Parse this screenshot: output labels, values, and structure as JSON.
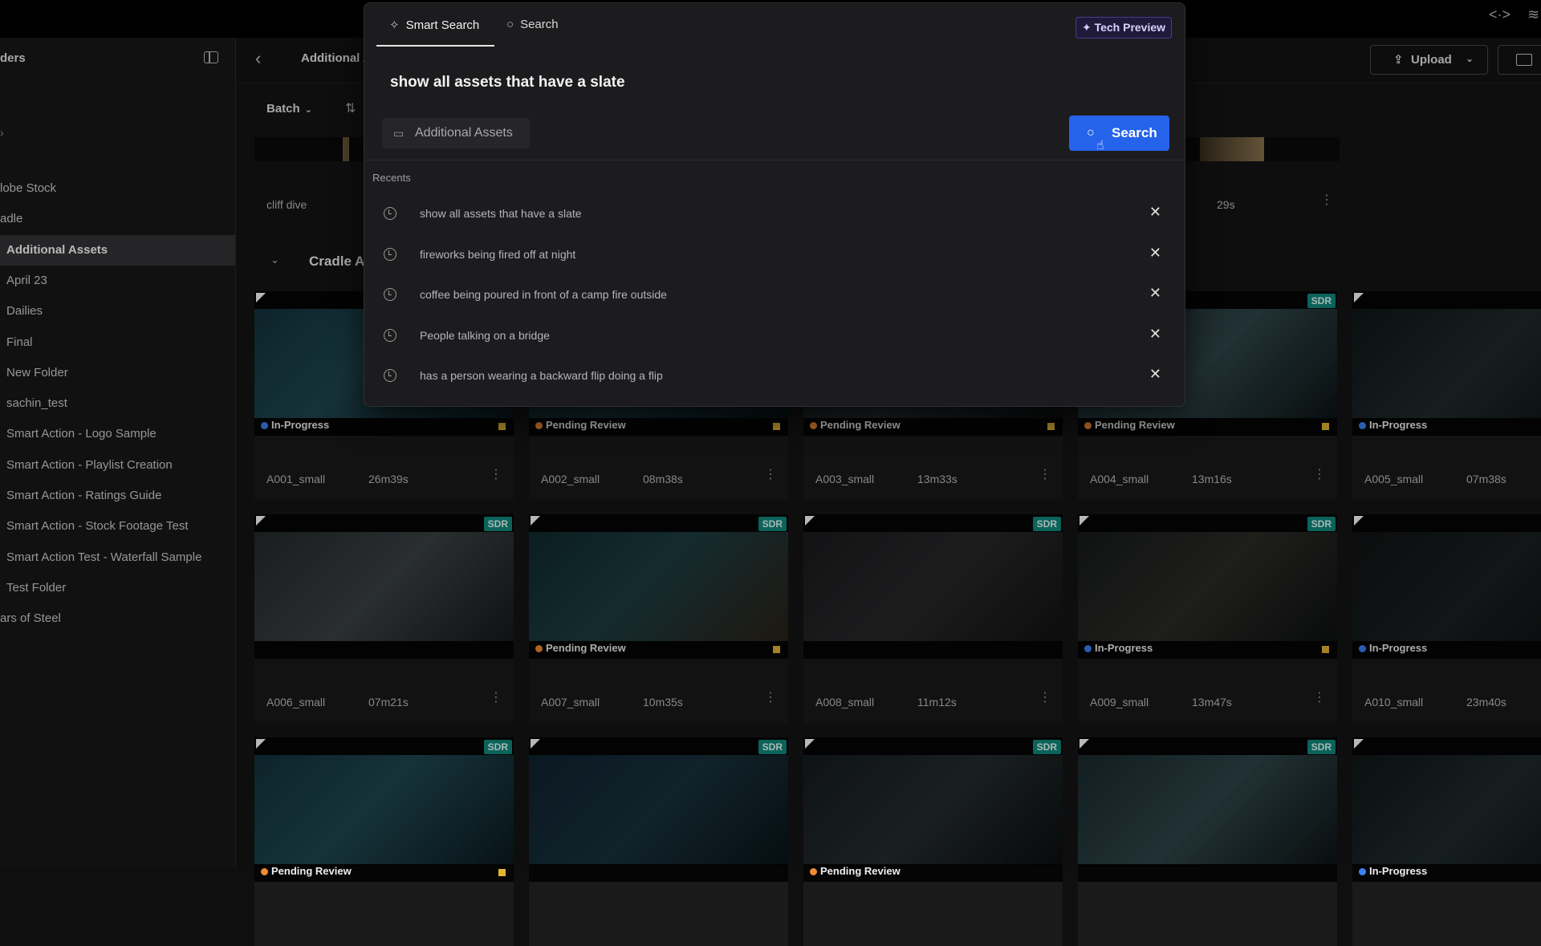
{
  "sidebar": {
    "title": "ders",
    "folders": [
      {
        "label": "lobe Stock",
        "cut": true
      },
      {
        "label": "adle",
        "cut": true
      },
      {
        "label": "Additional Assets",
        "active": true
      },
      {
        "label": "April 23"
      },
      {
        "label": "Dailies"
      },
      {
        "label": "Final"
      },
      {
        "label": "New Folder"
      },
      {
        "label": "sachin_test"
      },
      {
        "label": "Smart Action - Logo Sample"
      },
      {
        "label": "Smart Action - Playlist Creation"
      },
      {
        "label": "Smart Action - Ratings Guide"
      },
      {
        "label": "Smart Action - Stock Footage Test"
      },
      {
        "label": "Smart Action Test - Waterfall Sample"
      },
      {
        "label": "Test Folder"
      },
      {
        "label": "ars of Steel",
        "cut": true
      }
    ]
  },
  "header": {
    "breadcrumb": "Additional A",
    "upload_label": "Upload",
    "batch_label": "Batch"
  },
  "cliff": {
    "name": "cliff dive",
    "duration": "29s"
  },
  "section": {
    "title": "Cradle A"
  },
  "colors": {
    "accent": "#2563eb",
    "sdr": "#10897d",
    "in_progress": "#3b82f6",
    "pending": "#f28b30",
    "flag": "#e2b431"
  },
  "cards": [
    {
      "name": "A001_small",
      "duration": "26m39s",
      "status": "In-Progress",
      "sdr": false,
      "flag": true
    },
    {
      "name": "A002_small",
      "duration": "08m38s",
      "status": "Pending Review",
      "sdr": false,
      "flag": true
    },
    {
      "name": "A003_small",
      "duration": "13m33s",
      "status": "Pending Review",
      "sdr": false,
      "flag": true
    },
    {
      "name": "A004_small",
      "duration": "13m16s",
      "status": "Pending Review",
      "sdr": true,
      "flag": true
    },
    {
      "name": "A005_small",
      "duration": "07m38s",
      "status": "In-Progress",
      "sdr": false,
      "flag": false
    },
    {
      "name": "A006_small",
      "duration": "07m21s",
      "status": "",
      "sdr": true,
      "flag": false
    },
    {
      "name": "A007_small",
      "duration": "10m35s",
      "status": "Pending Review",
      "sdr": true,
      "flag": true
    },
    {
      "name": "A008_small",
      "duration": "11m12s",
      "status": "",
      "sdr": true,
      "flag": false
    },
    {
      "name": "A009_small",
      "duration": "13m47s",
      "status": "In-Progress",
      "sdr": true,
      "flag": true
    },
    {
      "name": "A010_small",
      "duration": "23m40s",
      "status": "In-Progress",
      "sdr": false,
      "flag": false
    },
    {
      "name": "",
      "duration": "",
      "status": "Pending Review",
      "sdr": true,
      "flag": true
    },
    {
      "name": "",
      "duration": "",
      "status": "",
      "sdr": true,
      "flag": false
    },
    {
      "name": "",
      "duration": "",
      "status": "Pending Review",
      "sdr": true,
      "flag": false
    },
    {
      "name": "",
      "duration": "",
      "status": "",
      "sdr": true,
      "flag": false
    },
    {
      "name": "",
      "duration": "",
      "status": "In-Progress",
      "sdr": false,
      "flag": false
    }
  ],
  "sdr_label": "SDR",
  "modal": {
    "tab_smart": "Smart Search",
    "tab_search": "Search",
    "tech_preview": "Tech Preview",
    "query": "show all assets that have a slate",
    "scope": "Additional Assets",
    "search_button": "Search",
    "recents_label": "Recents",
    "recents": [
      "show all assets that have a slate",
      "fireworks being fired off at night",
      "coffee being poured in front of a camp fire outside",
      "People talking on a bridge",
      "has a person wearing a backward flip doing a flip"
    ]
  }
}
